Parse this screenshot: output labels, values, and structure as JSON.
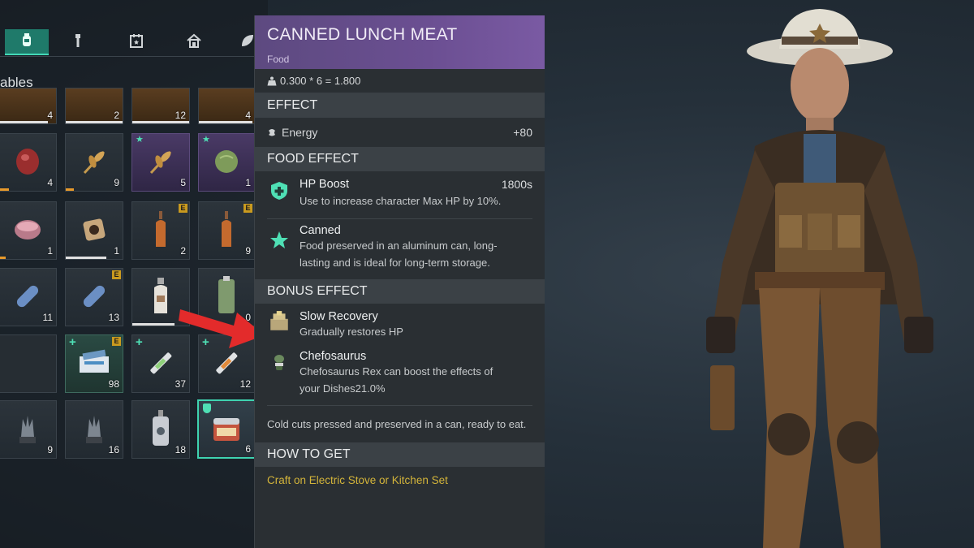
{
  "tabs": [
    {
      "icon": "bottle-icon",
      "active": true
    },
    {
      "icon": "wrench-icon",
      "active": false
    },
    {
      "icon": "calendar-icon",
      "active": false
    },
    {
      "icon": "house-icon",
      "active": false
    },
    {
      "icon": "leaf-icon",
      "active": false
    }
  ],
  "inventory": {
    "section_title": "ables",
    "slots": [
      {
        "count": "4"
      },
      {
        "count": "2"
      },
      {
        "count": "12"
      },
      {
        "count": "4"
      },
      {
        "count": "4"
      },
      {
        "count": "9"
      },
      {
        "count": "5"
      },
      {
        "count": "1"
      },
      {
        "count": "1"
      },
      {
        "count": "1"
      },
      {
        "count": "2"
      },
      {
        "count": "9"
      },
      {
        "count": "11"
      },
      {
        "count": "13"
      },
      {
        "count": ""
      },
      {
        "count": "0"
      },
      {
        "count": ""
      },
      {
        "count": "98"
      },
      {
        "count": "37"
      },
      {
        "count": "12"
      },
      {
        "count": "9"
      },
      {
        "count": "16"
      },
      {
        "count": "18"
      },
      {
        "count": "6"
      }
    ]
  },
  "tooltip": {
    "title": "CANNED LUNCH MEAT",
    "category": "Food",
    "weight": "0.300 * 6 = 1.800",
    "effect_header": "EFFECT",
    "effect_label": "Energy",
    "effect_value": "+80",
    "food_effect_header": "FOOD EFFECT",
    "hp_boost_name": "HP Boost",
    "hp_boost_duration": "1800s",
    "hp_boost_desc": "Use to increase character Max HP by 10%.",
    "canned_name": "Canned",
    "canned_desc": "Food preserved in an aluminum can, long-lasting and is ideal for long-term storage.",
    "bonus_effect_header": "BONUS EFFECT",
    "slow_recovery_name": "Slow Recovery",
    "slow_recovery_desc": "Gradually restores HP",
    "chefosaurus_name": "Chefosaurus",
    "chefosaurus_desc": "Chefosaurus Rex can boost the effects of your Dishes21.0%",
    "description": "Cold cuts pressed and preserved in a can, ready to eat.",
    "how_to_get_header": "HOW TO GET",
    "how_to_get": "Craft on Electric Stove or Kitchen Set"
  },
  "colors": {
    "accent": "#43d8b7",
    "header_purple": "#6b4f92",
    "how_to_get_text": "#d3b43a",
    "arrow": "#e32b2b"
  }
}
